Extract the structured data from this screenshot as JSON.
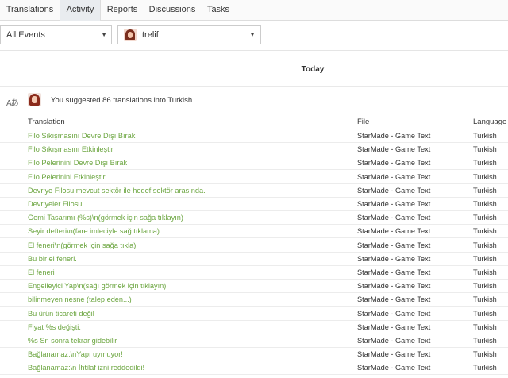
{
  "tabs": [
    "Translations",
    "Activity",
    "Reports",
    "Discussions",
    "Tasks"
  ],
  "filters": {
    "events": "All Events",
    "user": "trelif"
  },
  "day_label": "Today",
  "event": {
    "summary": "You suggested 86 translations into Turkish",
    "icon": "translate-icon"
  },
  "table": {
    "headers": [
      "Translation",
      "File",
      "Language"
    ],
    "rows": [
      {
        "translation": "Filo Sıkışmasını Devre Dışı Bırak",
        "file": "StarMade - Game Text",
        "language": "Turkish"
      },
      {
        "translation": "Filo Sıkışmasını Etkinleştir",
        "file": "StarMade - Game Text",
        "language": "Turkish"
      },
      {
        "translation": "Filo Pelerinini Devre Dışı Bırak",
        "file": "StarMade - Game Text",
        "language": "Turkish"
      },
      {
        "translation": "Filo Pelerinini Etkinleştir",
        "file": "StarMade - Game Text",
        "language": "Turkish"
      },
      {
        "translation": "Devriye Filosu mevcut sektör ile hedef sektör arasında.",
        "file": "StarMade - Game Text",
        "language": "Turkish"
      },
      {
        "translation": "Devriyeler Filosu",
        "file": "StarMade - Game Text",
        "language": "Turkish"
      },
      {
        "translation": "Gemi Tasarımı (%s)\\n(görmek için sağa tıklayın)",
        "file": "StarMade - Game Text",
        "language": "Turkish"
      },
      {
        "translation": "Seyir defteri\\n(fare imleciyle sağ tıklama)",
        "file": "StarMade - Game Text",
        "language": "Turkish"
      },
      {
        "translation": "El feneri\\n(görmek için sağa tıkla)",
        "file": "StarMade - Game Text",
        "language": "Turkish"
      },
      {
        "translation": "Bu bir el feneri.",
        "file": "StarMade - Game Text",
        "language": "Turkish"
      },
      {
        "translation": "El feneri",
        "file": "StarMade - Game Text",
        "language": "Turkish"
      },
      {
        "translation": "Engelleyici Yap\\n(sağı görmek için tıklayın)",
        "file": "StarMade - Game Text",
        "language": "Turkish"
      },
      {
        "translation": "bilinmeyen nesne (talep eden...)",
        "file": "StarMade - Game Text",
        "language": "Turkish"
      },
      {
        "translation": "Bu ürün ticareti değil",
        "file": "StarMade - Game Text",
        "language": "Turkish"
      },
      {
        "translation": "Fiyat %s değişti.",
        "file": "StarMade - Game Text",
        "language": "Turkish"
      },
      {
        "translation": "%s Sn sonra tekrar gidebilir",
        "file": "StarMade - Game Text",
        "language": "Turkish"
      },
      {
        "translation": "Bağlanamaz:\\nYapı uymuyor!",
        "file": "StarMade - Game Text",
        "language": "Turkish"
      },
      {
        "translation": "Bağlanamaz:\\n İhtilaf izni reddedildi!",
        "file": "StarMade - Game Text",
        "language": "Turkish"
      }
    ]
  },
  "colors": {
    "translation_link": "#6ba53f",
    "active_tab_bg": "#e9ecef"
  }
}
